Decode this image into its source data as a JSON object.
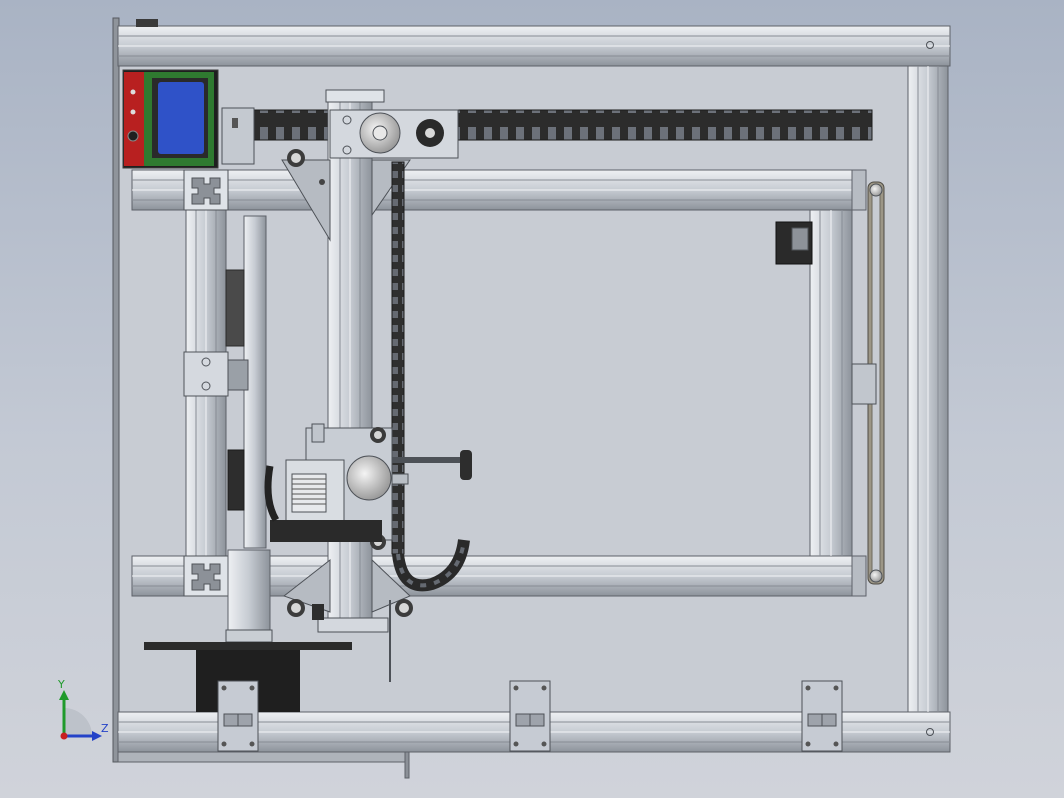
{
  "triad": {
    "y_label": "Y",
    "z_label": "Z",
    "colors": {
      "y": "#1f9a2b",
      "z": "#2442c8",
      "x": "#c82020"
    }
  },
  "palette": {
    "profile_light": "#dfe3e8",
    "profile_mid": "#b9bfc7",
    "profile_dark": "#6f757d",
    "panel_fill": "#c9ced6",
    "belt": "#3a3a3a",
    "lcd_blue": "#2f52c8",
    "lcd_board": "#b82020"
  }
}
